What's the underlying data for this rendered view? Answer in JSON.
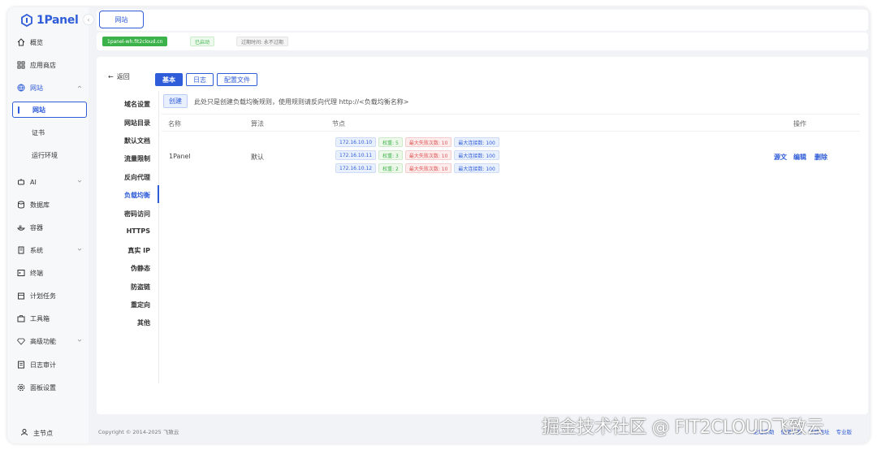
{
  "app": {
    "name": "1Panel"
  },
  "sidebar": {
    "items": [
      {
        "label": "概览",
        "icon": "home-icon"
      },
      {
        "label": "应用商店",
        "icon": "grid-icon"
      },
      {
        "label": "网站",
        "icon": "globe-icon"
      },
      {
        "label": "AI",
        "icon": "robot-icon"
      },
      {
        "label": "数据库",
        "icon": "database-icon"
      },
      {
        "label": "容器",
        "icon": "container-icon"
      },
      {
        "label": "系统",
        "icon": "system-icon"
      },
      {
        "label": "终端",
        "icon": "terminal-icon"
      },
      {
        "label": "计划任务",
        "icon": "calendar-icon"
      },
      {
        "label": "工具箱",
        "icon": "toolbox-icon"
      },
      {
        "label": "高级功能",
        "icon": "diamond-icon"
      },
      {
        "label": "日志审计",
        "icon": "log-icon"
      },
      {
        "label": "面板设置",
        "icon": "settings-icon"
      }
    ],
    "website_sub": [
      "网站",
      "证书",
      "运行环境"
    ],
    "footer_label": "主节点"
  },
  "tabbar": {
    "tab_label": "网站"
  },
  "infobar": {
    "site_name": "1panel-wh.fit2cloud.cn",
    "status": "已启动",
    "expire": "过期时间: 永不过期"
  },
  "main": {
    "back_label": "返回",
    "segments": [
      "基本",
      "日志",
      "配置文件"
    ],
    "vnav": [
      "域名设置",
      "网站目录",
      "默认文档",
      "流量限制",
      "反向代理",
      "负载均衡",
      "密码访问",
      "HTTPS",
      "真实 IP",
      "伪静态",
      "防盗链",
      "重定向",
      "其他"
    ],
    "create_label": "创建",
    "hint": "此处只是创建负载均衡规则，使用规则请反向代理 http://<负载均衡名称>",
    "table": {
      "headers": [
        "名称",
        "算法",
        "节点",
        "操作"
      ],
      "row": {
        "name": "1Panel",
        "algorithm": "默认",
        "nodes": [
          {
            "ip": "172.16.10.10",
            "weight": "权重: 5",
            "fail": "最大失败次数: 10",
            "conn": "最大连接数: 100"
          },
          {
            "ip": "172.16.10.11",
            "weight": "权重: 3",
            "fail": "最大失败次数: 10",
            "conn": "最大连接数: 100"
          },
          {
            "ip": "172.16.10.12",
            "weight": "权重: 2",
            "fail": "最大失败次数: 10",
            "conn": "最大连接数: 100"
          }
        ],
        "ops": [
          "源文",
          "编辑",
          "删除"
        ]
      }
    }
  },
  "footer": {
    "copyright": "Copyright © 2014-2025 飞致云",
    "links": [
      "论坛求助",
      "使用手册",
      "项目地址",
      "专业版"
    ]
  },
  "watermark": "掘金技术社区 @ FIT2CLOUD飞致云",
  "colors": {
    "primary": "#2f5cd8",
    "success": "#3cb24a",
    "danger": "#e05555"
  }
}
